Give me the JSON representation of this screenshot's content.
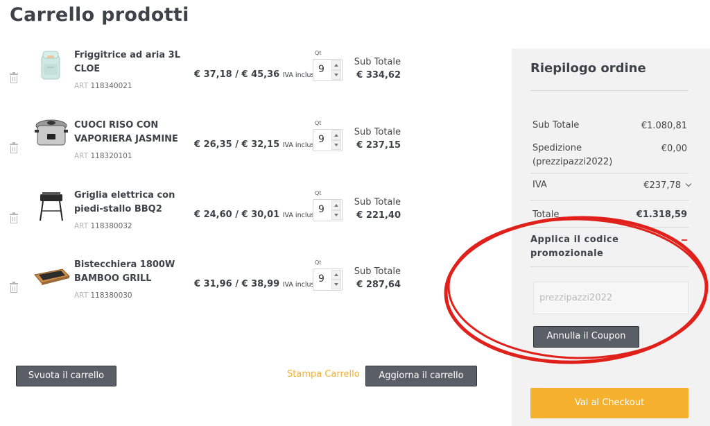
{
  "page": {
    "title": "Carrello prodotti"
  },
  "cart": {
    "qty_label": "Qt",
    "subtotal_label": "Sub Totale",
    "iva_label": "IVA inclusa",
    "art_label": "ART",
    "items": [
      {
        "name": "Friggitrice ad aria 3L CLOE",
        "art": "118340021",
        "price": "€ 37,18 / € 45,36",
        "qty": "9",
        "subtotal": "€ 334,62"
      },
      {
        "name": "CUOCI RISO CON VAPORIERA JASMINE",
        "art": "118320101",
        "price": "€ 26,35 / € 32,15",
        "qty": "9",
        "subtotal": "€ 237,15"
      },
      {
        "name": "Griglia elettrica con piedi-stallo BBQ2",
        "art": "118380032",
        "price": "€ 24,60 / € 30,01",
        "qty": "9",
        "subtotal": "€ 221,40"
      },
      {
        "name": "Bistecchiera 1800W BAMBOO GRILL",
        "art": "118380030",
        "price": "€ 31,96 / € 38,99",
        "qty": "9",
        "subtotal": "€ 287,64"
      }
    ]
  },
  "actions": {
    "empty_cart": "Svuota il carrello",
    "print_cart": "Stampa Carrello",
    "update_cart": "Aggiorna il carrello"
  },
  "summary": {
    "title": "Riepilogo ordine",
    "subtotal_label": "Sub Totale",
    "subtotal_value": "€1.080,81",
    "shipping_label": "Spedizione (prezzipazzi2022)",
    "shipping_value": "€0,00",
    "vat_label": "IVA",
    "vat_value": "€237,78",
    "total_label": "Totale",
    "total_value": "€1.318,59",
    "promo_title": "Applica il codice promozionale",
    "coupon_placeholder": "prezzipazzi2022",
    "cancel_coupon": "Annulla il Coupon",
    "checkout": "Vai al Checkout"
  },
  "colors": {
    "accent": "#f5b02e",
    "dark_button": "#5a5e66",
    "annotation_circle": "#e0211b",
    "summary_bg": "#f2f2f2"
  }
}
